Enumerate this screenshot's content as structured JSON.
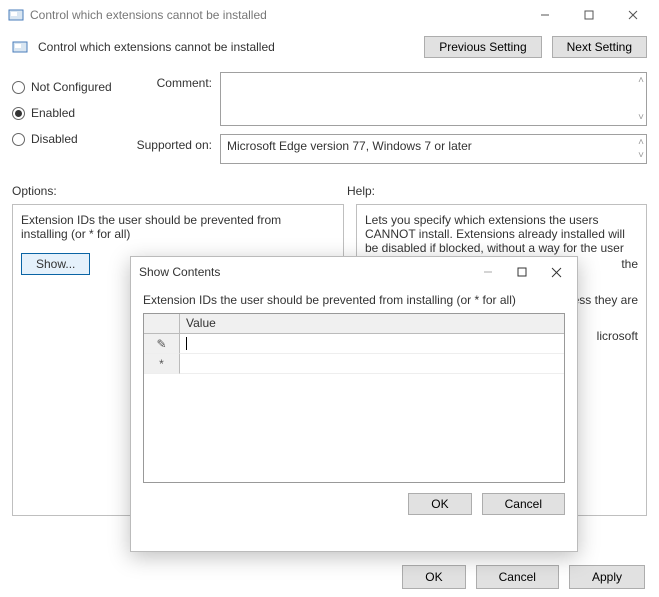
{
  "titlebar": {
    "title": "Control which extensions cannot be installed"
  },
  "header": {
    "title": "Control which extensions cannot be installed",
    "previous": "Previous Setting",
    "next": "Next Setting"
  },
  "radios": {
    "not_configured": "Not Configured",
    "enabled": "Enabled",
    "disabled": "Disabled",
    "selected": "enabled"
  },
  "fields": {
    "comment_label": "Comment:",
    "comment_value": "",
    "supported_label": "Supported on:",
    "supported_value": "Microsoft Edge version 77, Windows 7 or later"
  },
  "sections": {
    "options": "Options:",
    "help": "Help:"
  },
  "options": {
    "prevent_label": "Extension IDs the user should be prevented from installing (or * for all)",
    "show": "Show..."
  },
  "help_text": "Lets you specify which extensions the users CANNOT install. Extensions already installed will be disabled if blocked, without a way for the user",
  "help_tail1": "the",
  "help_tail2": "ess they are",
  "help_tail3": "licrosoft",
  "buttons": {
    "ok": "OK",
    "cancel": "Cancel",
    "apply": "Apply"
  },
  "modal": {
    "title": "Show Contents",
    "instruction": "Extension IDs the user should be prevented from installing (or * for all)",
    "column": "Value",
    "rows": [
      {
        "marker": "✎",
        "value": ""
      },
      {
        "marker": "*",
        "value": ""
      }
    ],
    "ok": "OK",
    "cancel": "Cancel"
  }
}
